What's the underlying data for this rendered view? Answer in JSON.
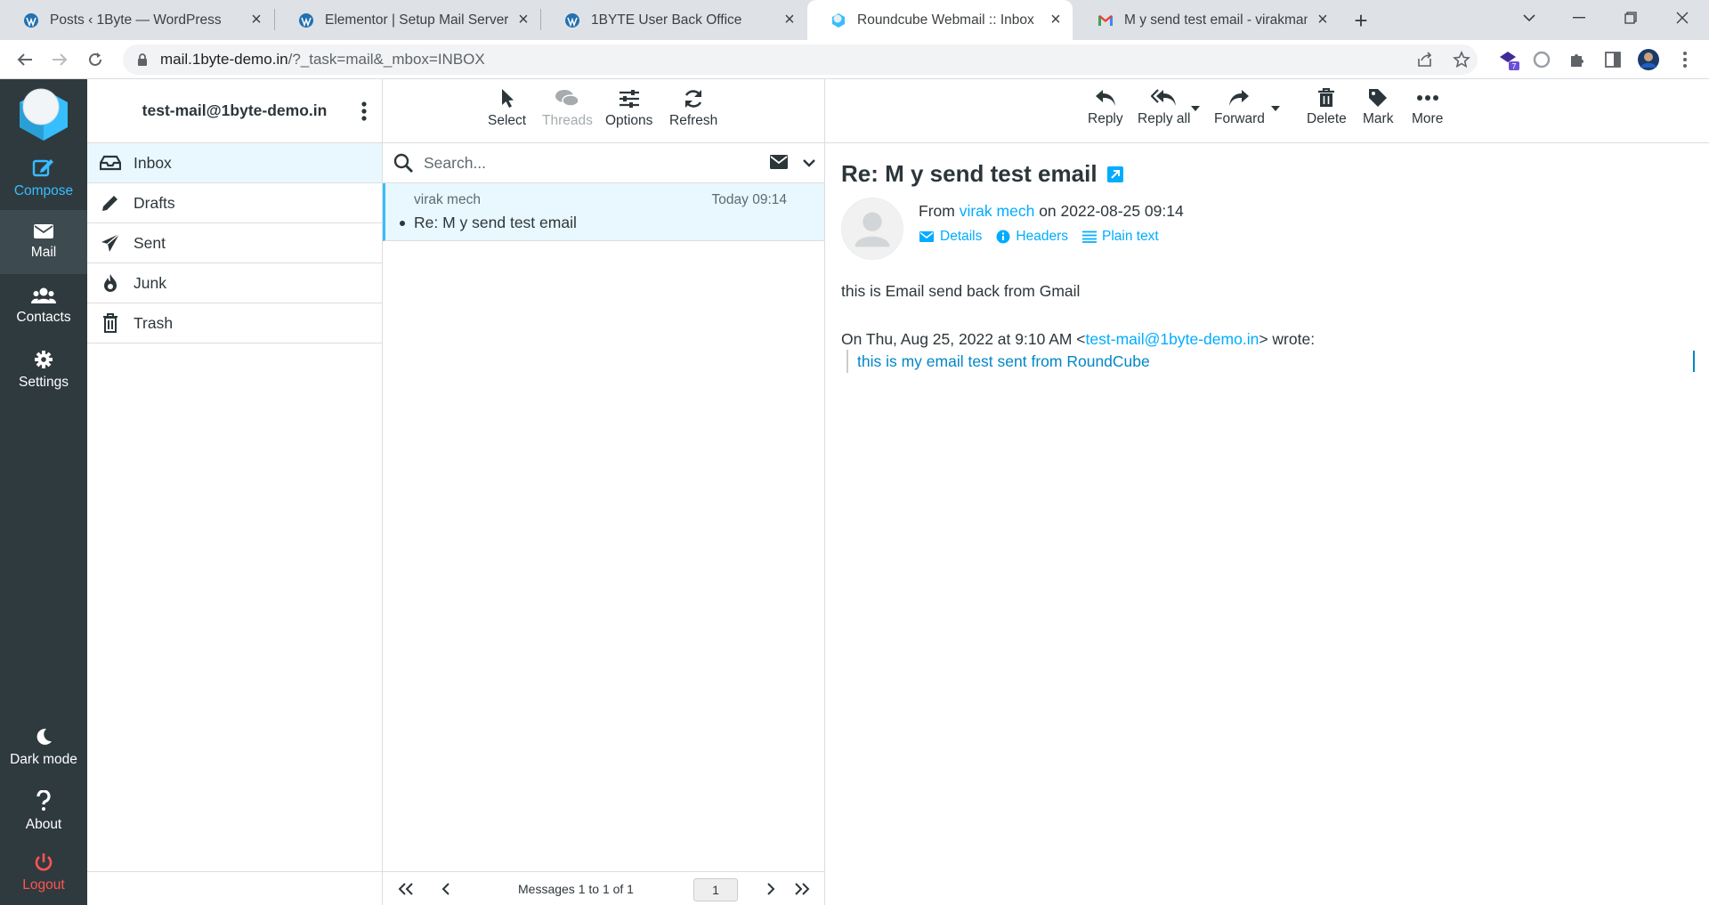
{
  "browser": {
    "tabs": [
      {
        "title": "Posts ‹ 1Byte — WordPress",
        "active": false
      },
      {
        "title": "Elementor | Setup Mail Server (Ro",
        "active": false
      },
      {
        "title": "1BYTE User Back Office",
        "active": false
      },
      {
        "title": "Roundcube Webmail :: Inbox",
        "active": true
      },
      {
        "title": "M y send test email - virakmamo",
        "active": false
      }
    ],
    "url_host": "mail.1byte-demo.in",
    "url_path": "/?_task=mail&_mbox=INBOX",
    "extension_badge": "7"
  },
  "rail": {
    "compose": "Compose",
    "mail": "Mail",
    "contacts": "Contacts",
    "settings": "Settings",
    "dark_mode": "Dark mode",
    "about": "About",
    "logout": "Logout"
  },
  "folders": {
    "account": "test-mail@1byte-demo.in",
    "items": [
      {
        "label": "Inbox",
        "icon": "inbox-icon",
        "selected": true
      },
      {
        "label": "Drafts",
        "icon": "pencil-icon",
        "selected": false
      },
      {
        "label": "Sent",
        "icon": "paper-plane-icon",
        "selected": false
      },
      {
        "label": "Junk",
        "icon": "fire-icon",
        "selected": false
      },
      {
        "label": "Trash",
        "icon": "trash-icon",
        "selected": false
      }
    ]
  },
  "list_toolbar": {
    "select": "Select",
    "threads": "Threads",
    "options": "Options",
    "refresh": "Refresh"
  },
  "search": {
    "placeholder": "Search..."
  },
  "messages": [
    {
      "from": "virak mech",
      "date": "Today 09:14",
      "subject": "Re: M y send test email",
      "unread": true
    }
  ],
  "list_footer": {
    "count": "Messages 1 to 1 of 1",
    "page": "1"
  },
  "preview_toolbar": {
    "reply": "Reply",
    "reply_all": "Reply all",
    "forward": "Forward",
    "delete": "Delete",
    "mark": "Mark",
    "more": "More"
  },
  "message": {
    "subject": "Re: M y send test email",
    "from_prefix": "From",
    "from_name": "virak mech",
    "date_prefix": "on",
    "date": "2022-08-25 09:14",
    "links": {
      "details": "Details",
      "headers": "Headers",
      "plain_text": "Plain text"
    },
    "body": "this is Email send back from Gmail",
    "quote_prefix": "On Thu, Aug 25, 2022 at 9:10 AM <",
    "quote_email": "test-mail@1byte-demo.in",
    "quote_suffix": "> wrote:",
    "quoted_text": "this is my email test sent from RoundCube"
  },
  "colors": {
    "accent": "#37beff",
    "link": "#00acff",
    "rail_bg": "#2f3a3f",
    "selected_bg": "#e9f7ff",
    "logout": "#ff5552"
  }
}
